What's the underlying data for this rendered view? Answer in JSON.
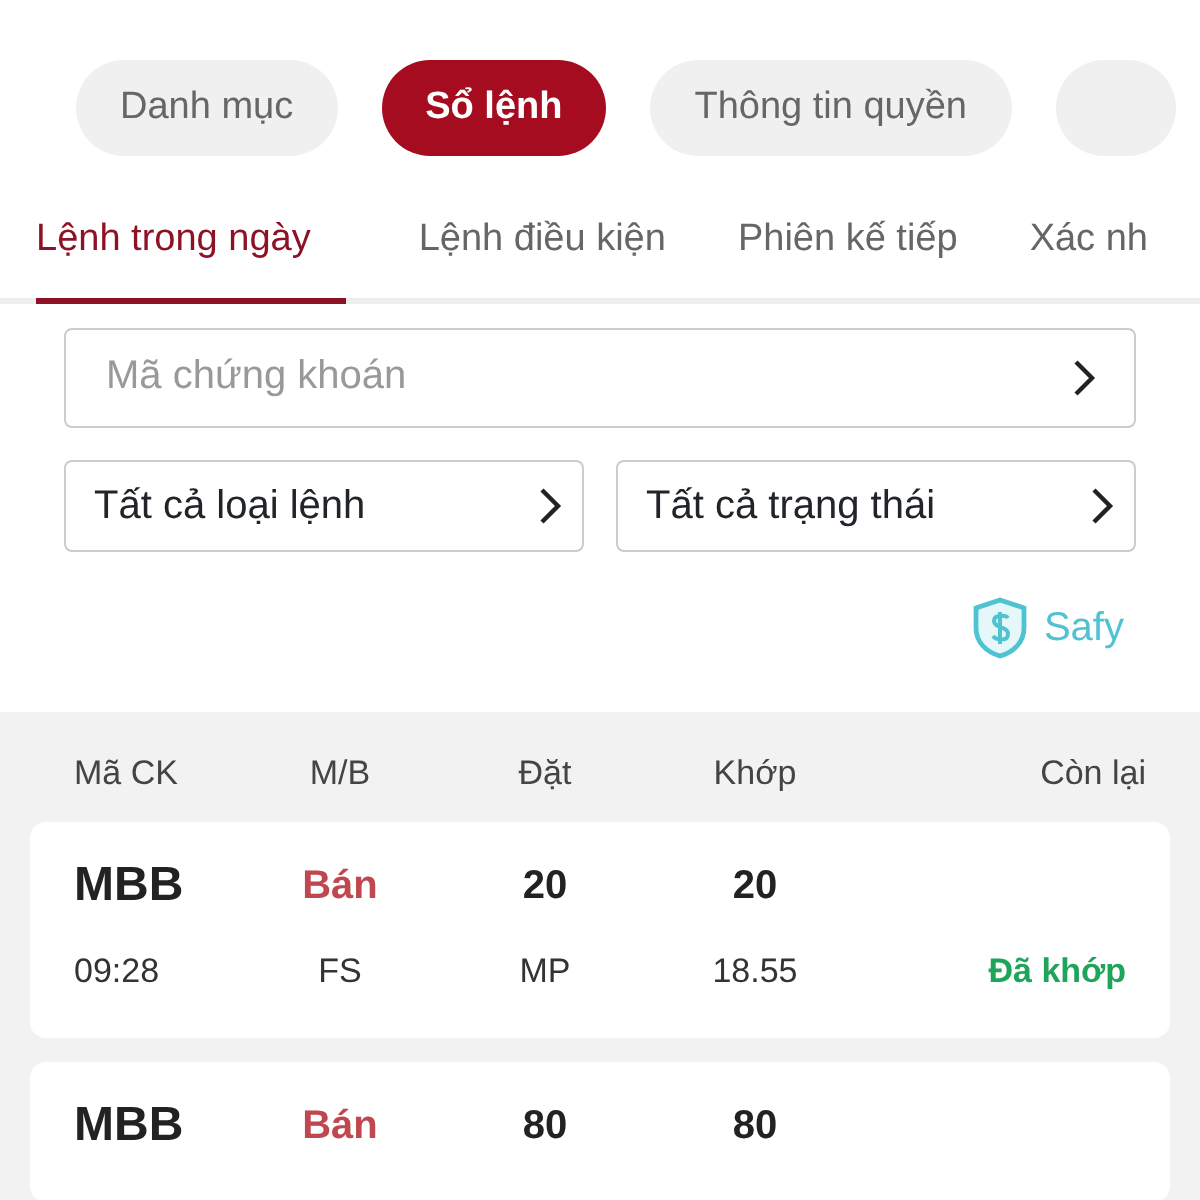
{
  "pills": [
    {
      "label": "Danh mục",
      "selected": false
    },
    {
      "label": "Sổ lệnh",
      "selected": true
    },
    {
      "label": "Thông tin quyền",
      "selected": false
    },
    {
      "selected": false
    }
  ],
  "tabs": [
    {
      "label": "Lệnh trong ngày",
      "selected": true
    },
    {
      "label": "Lệnh điều kiện",
      "selected": false
    },
    {
      "label": "Phiên kế tiếp",
      "selected": false
    },
    {
      "label": "Xác nh",
      "selected": false
    }
  ],
  "search": {
    "placeholder": "Mã chứng khoán"
  },
  "filters": [
    {
      "value": "Tất cả loại lệnh"
    },
    {
      "value": "Tất cả trạng thái"
    }
  ],
  "safy": {
    "label": "Safy"
  },
  "columns": [
    "Mã CK",
    "M/B",
    "Đặt",
    "Khớp",
    "Còn lại"
  ],
  "orders": [
    {
      "symbol": "MBB",
      "side": "Bán",
      "qty": "20",
      "matched": "20",
      "time": "09:28",
      "type": "FS",
      "price_type": "MP",
      "matched_price": "18.55",
      "status": "Đã khớp"
    },
    {
      "symbol": "MBB",
      "side": "Bán",
      "qty": "80",
      "matched": "80"
    }
  ]
}
